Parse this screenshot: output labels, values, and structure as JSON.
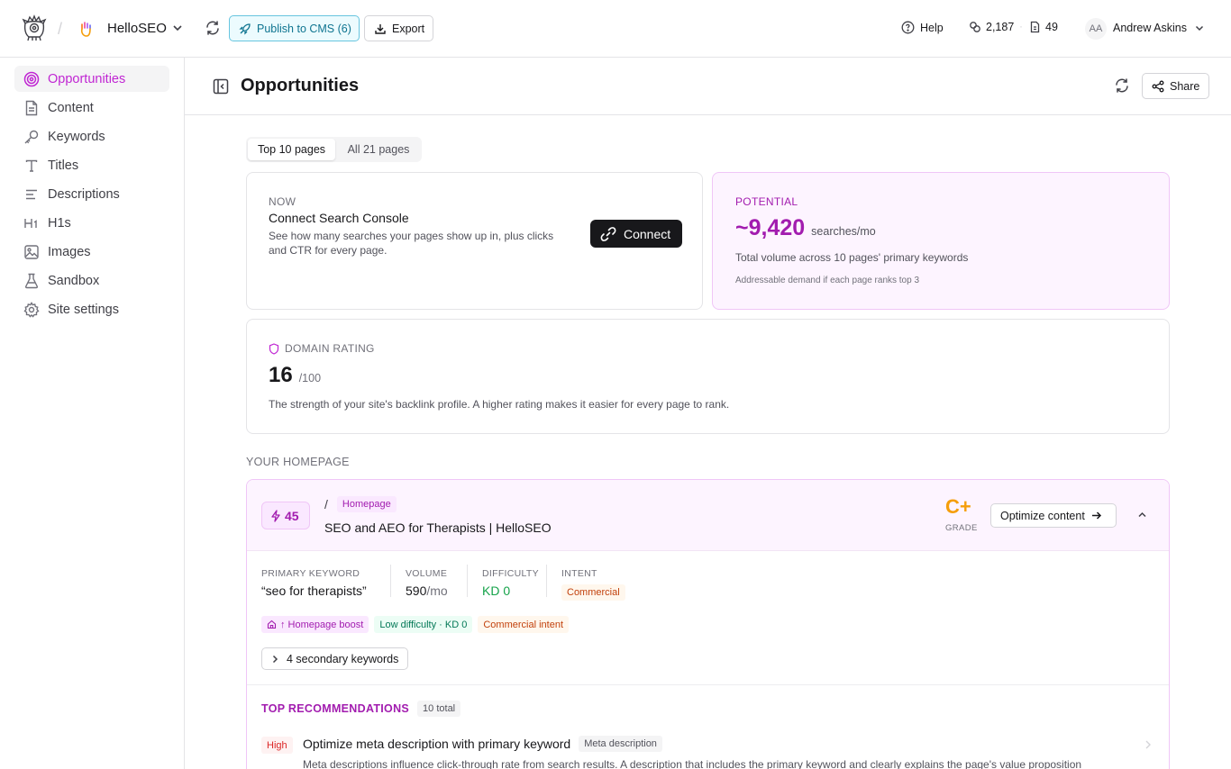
{
  "topbar": {
    "site_name": "HelloSEO",
    "publish_label": "Publish to CMS (6)",
    "export_label": "Export",
    "help_label": "Help",
    "stat_links": "2,187",
    "stat_pages": "49",
    "avatar_initials": "AA",
    "user_name": "Andrew Askins"
  },
  "sidebar": {
    "items": [
      {
        "label": "Opportunities",
        "icon": "target-icon",
        "active": true
      },
      {
        "label": "Content",
        "icon": "document-icon"
      },
      {
        "label": "Keywords",
        "icon": "key-icon"
      },
      {
        "label": "Titles",
        "icon": "type-icon"
      },
      {
        "label": "Descriptions",
        "icon": "align-left-icon"
      },
      {
        "label": "H1s",
        "icon": "heading1-icon"
      },
      {
        "label": "Images",
        "icon": "image-icon"
      },
      {
        "label": "Sandbox",
        "icon": "flask-icon"
      },
      {
        "label": "Site settings",
        "icon": "gear-icon"
      }
    ]
  },
  "header": {
    "title": "Opportunities",
    "share_label": "Share"
  },
  "tabs": [
    "Top 10 pages",
    "All 21 pages"
  ],
  "now_card": {
    "eyebrow": "NOW",
    "title": "Connect Search Console",
    "desc": "See how many searches your pages show up in, plus clicks and CTR for every page.",
    "button": "Connect"
  },
  "potential_card": {
    "eyebrow": "POTENTIAL",
    "value": "~9,420",
    "unit": "searches/mo",
    "desc": "Total volume across 10 pages' primary keywords",
    "note": "Addressable demand if each page ranks top 3"
  },
  "domain_card": {
    "eyebrow": "DOMAIN RATING",
    "value": "16",
    "max": "/100",
    "desc": "The strength of your site's backlink profile. A higher rating makes it easier for every page to rank."
  },
  "homepage_section_label": "YOUR HOMEPAGE",
  "homepage": {
    "score": "45",
    "path": "/",
    "path_badge": "Homepage",
    "title": "SEO and AEO for Therapists | HelloSEO",
    "grade": "C+",
    "grade_label": "GRADE",
    "optimize_label": "Optimize content",
    "primary_keyword_label": "PRIMARY KEYWORD",
    "primary_keyword": "“seo for therapists”",
    "volume_label": "VOLUME",
    "volume_value": "590",
    "volume_unit": "/mo",
    "difficulty_label": "DIFFICULTY",
    "difficulty_value": "KD 0",
    "intent_label": "INTENT",
    "intent_value": "Commercial",
    "tags": [
      "↑ Homepage boost",
      "Low difficulty · KD 0",
      "Commercial intent"
    ],
    "secondary_label": "4 secondary keywords"
  },
  "recommendations": {
    "heading": "TOP RECOMMENDATIONS",
    "count": "10 total",
    "items": [
      {
        "priority": "High",
        "title": "Optimize meta description with primary keyword",
        "tag": "Meta description",
        "desc": "Meta descriptions influence click-through rate from search results. A description that includes the primary keyword and clearly explains the page's value proposition"
      }
    ]
  },
  "colors": {
    "accent": "#c026d3",
    "grade": "#f59e0b",
    "publish": "#0e7490"
  }
}
